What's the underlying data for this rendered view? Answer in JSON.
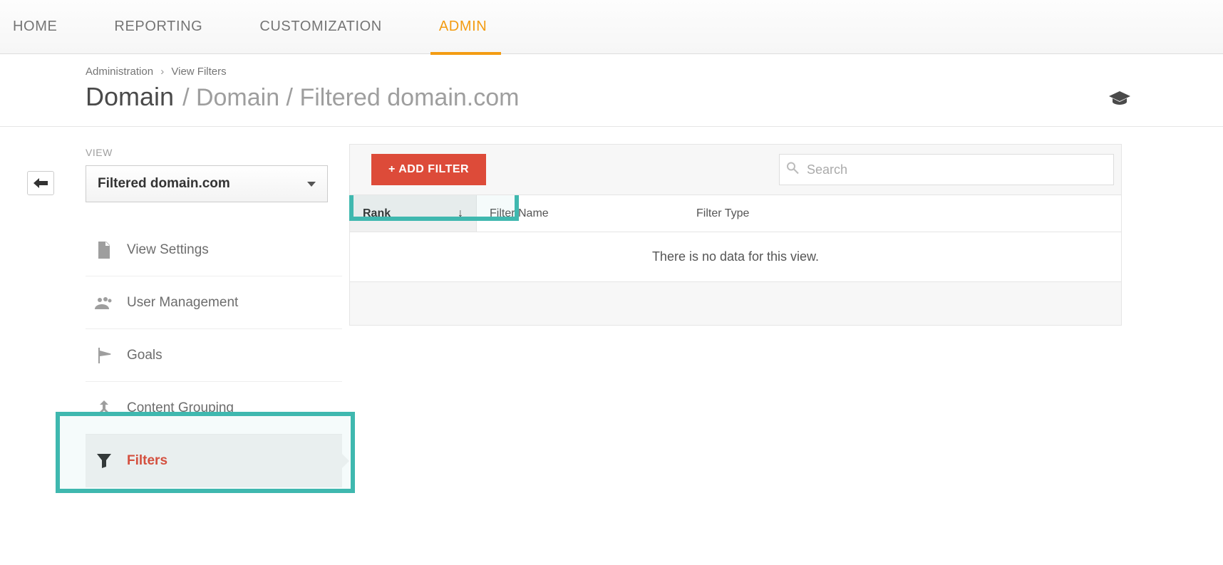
{
  "nav": {
    "items": [
      "HOME",
      "REPORTING",
      "CUSTOMIZATION",
      "ADMIN"
    ],
    "activeIndex": 3
  },
  "breadcrumb": {
    "items": [
      "Administration",
      "View Filters"
    ]
  },
  "title": {
    "main": "Domain",
    "path": "/ Domain / Filtered domain.com"
  },
  "sidebar": {
    "section_label": "VIEW",
    "selected_view": "Filtered domain.com",
    "items": [
      {
        "label": "View Settings",
        "icon": "file"
      },
      {
        "label": "User Management",
        "icon": "users"
      },
      {
        "label": "Goals",
        "icon": "flag"
      },
      {
        "label": "Content Grouping",
        "icon": "merge"
      },
      {
        "label": "Filters",
        "icon": "filter",
        "active": true
      }
    ]
  },
  "toolbar": {
    "add_filter_label": "+ ADD FILTER",
    "search_placeholder": "Search"
  },
  "table": {
    "columns": {
      "rank": "Rank",
      "name": "Filter Name",
      "type": "Filter Type"
    },
    "empty_message": "There is no data for this view."
  }
}
